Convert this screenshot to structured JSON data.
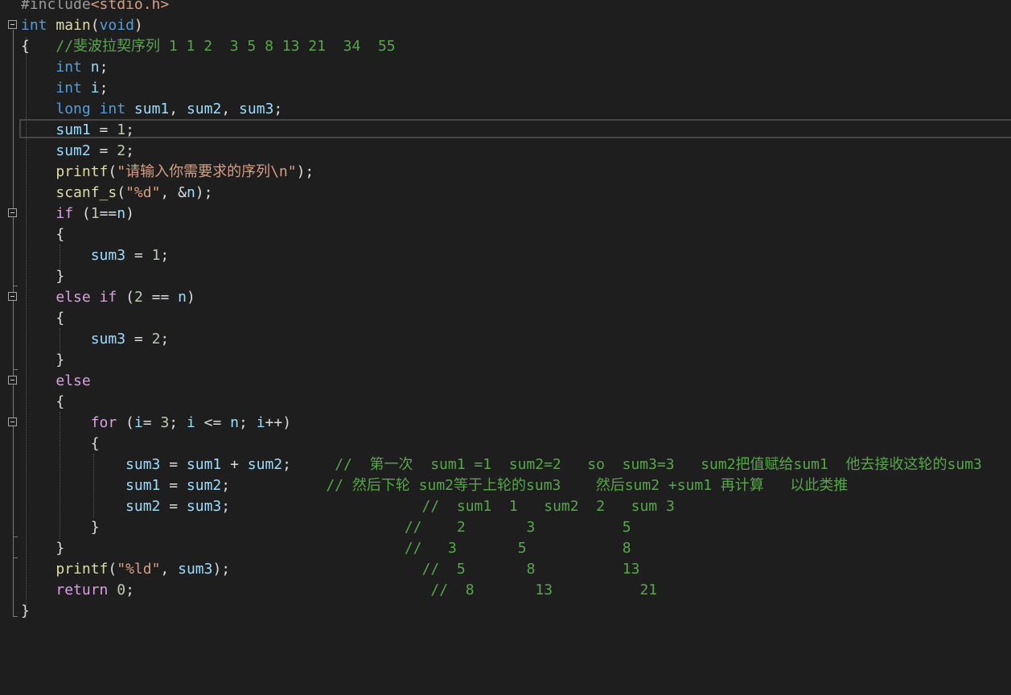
{
  "code": {
    "l0": {
      "a": "#include",
      "b": "<stdio.h>"
    },
    "l1": {
      "a": "int",
      "b": " ",
      "c": "main",
      "d": "(",
      "e": "void",
      "f": ")"
    },
    "l2": {
      "a": "{   ",
      "b": "//斐波拉契序列 1 1 2  3 5 8 13 21  34  55"
    },
    "l3": {
      "a": "    ",
      "b": "int",
      "c": " ",
      "d": "n",
      "e": ";"
    },
    "l4": {
      "a": "    ",
      "b": "int",
      "c": " ",
      "d": "i",
      "e": ";"
    },
    "l5": {
      "a": "    ",
      "b": "long",
      "c": " ",
      "d": "int",
      "e": " ",
      "f": "sum1",
      "g": ", ",
      "h": "sum2",
      "i": ", ",
      "j": "sum3",
      "k": ";"
    },
    "l6": {
      "a": "    ",
      "b": "sum1",
      "c": " = ",
      "d": "1",
      "e": ";"
    },
    "l7": {
      "a": "    ",
      "b": "sum2",
      "c": " = ",
      "d": "2",
      "e": ";"
    },
    "l8": {
      "a": "    ",
      "b": "printf",
      "c": "(",
      "d": "\"请输入你需要求的序列\\n\"",
      "e": ");"
    },
    "l9": {
      "a": "    ",
      "b": "scanf_s",
      "c": "(",
      "d": "\"%d\"",
      "e": ", &",
      "f": "n",
      "g": ");"
    },
    "l10": {
      "a": "    ",
      "b": "if",
      "c": " (",
      "d": "1",
      "e": "==",
      "f": "n",
      "g": ")"
    },
    "l11": {
      "a": "    {"
    },
    "l12": {
      "a": "        ",
      "b": "sum3",
      "c": " = ",
      "d": "1",
      "e": ";"
    },
    "l13": {
      "a": "    }"
    },
    "l14": {
      "a": "    ",
      "b": "else",
      "c": " ",
      "d": "if",
      "e": " (",
      "f": "2",
      "g": " == ",
      "h": "n",
      "i": ")"
    },
    "l15": {
      "a": "    {"
    },
    "l16": {
      "a": "        ",
      "b": "sum3",
      "c": " = ",
      "d": "2",
      "e": ";"
    },
    "l17": {
      "a": "    }"
    },
    "l18": {
      "a": "    ",
      "b": "else"
    },
    "l19": {
      "a": "    {"
    },
    "l20": {
      "a": "        ",
      "b": "for",
      "c": " (",
      "d": "i",
      "e": "= ",
      "f": "3",
      "g": "; ",
      "h": "i",
      "i": " <= ",
      "j": "n",
      "k": "; ",
      "l": "i",
      "m": "++)"
    },
    "l21": {
      "a": "        {"
    },
    "l22": {
      "a": "            ",
      "b": "sum3",
      "c": " = ",
      "d": "sum1",
      "e": " + ",
      "f": "sum2",
      "g": ";     ",
      "h": "//  第一次  sum1 =1  sum2=2   so  sum3=3   sum2把值赋给sum1  他去接收这轮的sum3"
    },
    "l23": {
      "a": "            ",
      "b": "sum1",
      "c": " = ",
      "d": "sum2",
      "e": ";           ",
      "f": "// 然后下轮 sum2等于上轮的sum3    然后sum2 +sum1 再计算   以此类推"
    },
    "l24": {
      "a": "            ",
      "b": "sum2",
      "c": " = ",
      "d": "sum3",
      "e": ";                      ",
      "f": "//  sum1  1   sum2  2   sum 3"
    },
    "l25": {
      "a": "        }                                   ",
      "b": "//    2       3          5"
    },
    "l26": {
      "a": "    }                                       ",
      "b": "//   3       5           8"
    },
    "l27": {
      "a": "    ",
      "b": "printf",
      "c": "(",
      "d": "\"%ld\"",
      "e": ", ",
      "f": "sum3",
      "g": ");                      ",
      "h": "//  5       8          13"
    },
    "l28": {
      "a": "    ",
      "b": "return",
      "c": " ",
      "d": "0",
      "e": ";                                  ",
      "f": "//  8       13          21"
    },
    "l29": {
      "a": "}"
    }
  },
  "colors": {
    "background": "#1e1e1e",
    "keyword": "#569cd6",
    "control_keyword": "#d8a0df",
    "function": "#dcdcaa",
    "variable": "#9cdcfe",
    "string": "#d69d85",
    "comment": "#57a64a",
    "number": "#b5cea8"
  }
}
